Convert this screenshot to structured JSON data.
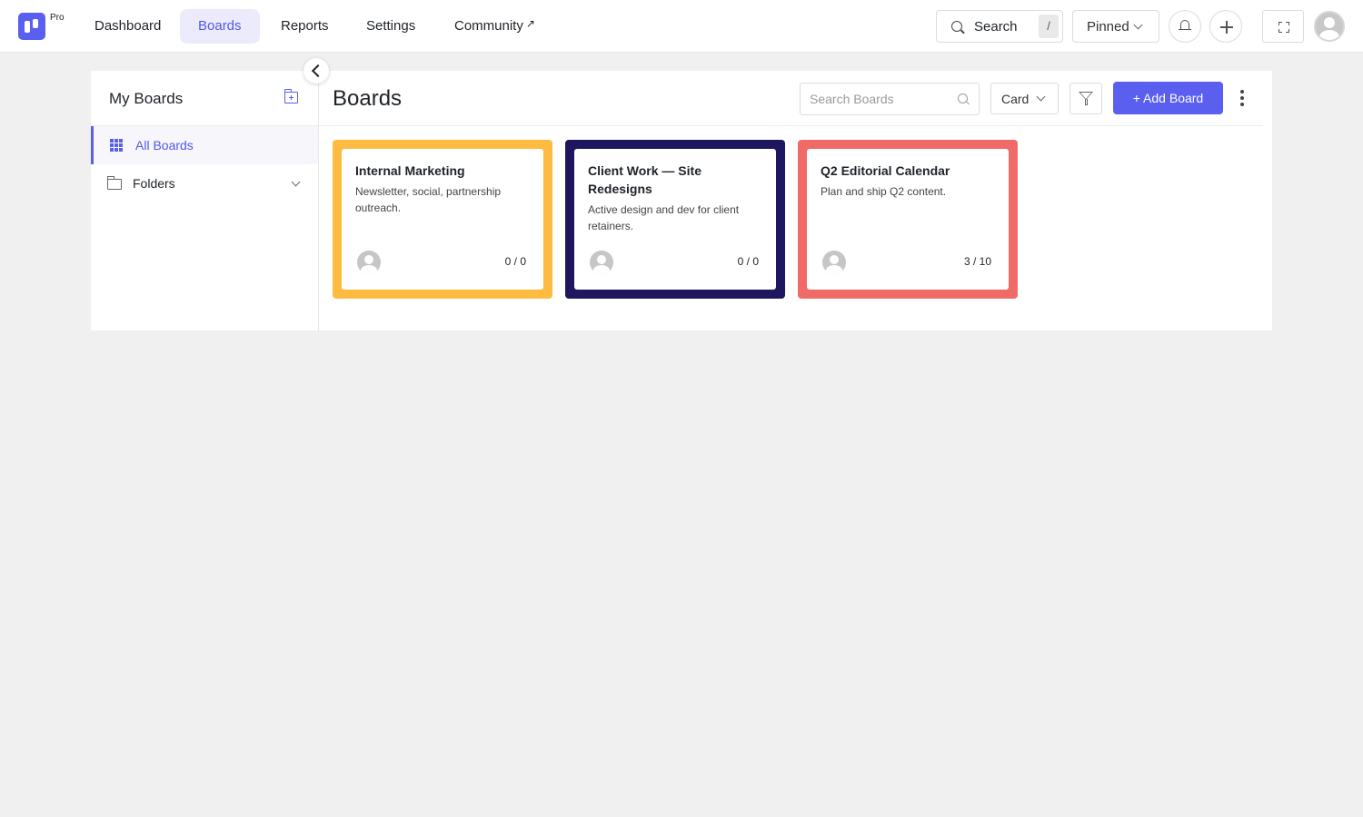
{
  "brand": {
    "badge": "Pro",
    "accent": "#5b5ff0"
  },
  "nav": {
    "items": [
      {
        "label": "Dashboard"
      },
      {
        "label": "Boards",
        "active": true
      },
      {
        "label": "Reports"
      },
      {
        "label": "Settings"
      },
      {
        "label": "Community",
        "external": true,
        "icon": "external-link-icon"
      }
    ]
  },
  "topbar": {
    "search": {
      "label": "Search",
      "shortcut": "/"
    },
    "pinned": {
      "label": "Pinned"
    },
    "icons": [
      "search-icon",
      "bell-icon",
      "plus-icon",
      "fullscreen-icon",
      "avatar"
    ]
  },
  "sidebar": {
    "title": "My Boards",
    "items": [
      {
        "label": "All Boards",
        "active": true,
        "icon": "grid-icon"
      },
      {
        "label": "Folders",
        "icon": "folder-icon",
        "expandable": true
      }
    ]
  },
  "main": {
    "title": "Boards",
    "search_placeholder": "Search Boards",
    "view_mode": "Card",
    "add_button": "+ Add Board"
  },
  "boards": [
    {
      "name": "Internal Marketing",
      "description": "Newsletter, social, partnership outreach.",
      "count": "0 / 0",
      "color": "#fdbc41"
    },
    {
      "name": "Client Work — Site Redesigns",
      "description": "Active design and dev for client retainers.",
      "count": "0 / 0",
      "color": "#1e165f"
    },
    {
      "name": "Q2 Editorial Calendar",
      "description": "Plan and ship Q2 content.",
      "count": "3 / 10",
      "color": "#f06b67"
    }
  ]
}
